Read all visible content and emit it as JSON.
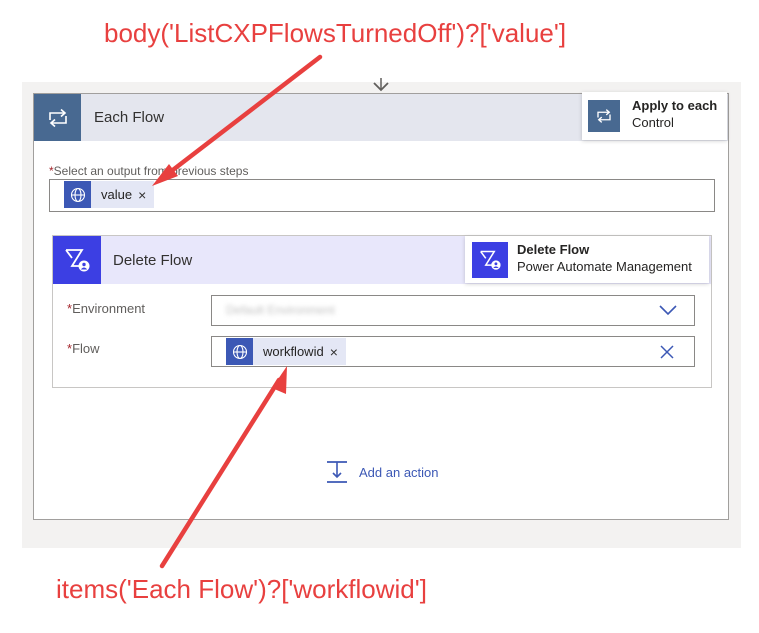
{
  "annotations": {
    "top": "body('ListCXPFlowsTurnedOff')?['value']",
    "bottom": "items('Each  Flow')?['workflowid']"
  },
  "loop": {
    "title": "Each Flow",
    "icon": "loop-icon",
    "tooltip": {
      "name": "Apply to each",
      "connector": "Control"
    },
    "select_label_required": "*",
    "select_label": "Select an output from previous steps",
    "token": {
      "label": "value",
      "remove": "×",
      "icon": "globe-icon"
    }
  },
  "action": {
    "title": "Delete Flow",
    "icon": "power-automate-management-icon",
    "tooltip": {
      "name": "Delete Flow",
      "connector": "Power Automate Management"
    },
    "fields": {
      "environment": {
        "required": "*",
        "label": "Environment",
        "value": "Default Environment"
      },
      "flow": {
        "required": "*",
        "label": "Flow",
        "token": {
          "label": "workflowid",
          "remove": "×",
          "icon": "globe-icon"
        }
      }
    }
  },
  "add_action": {
    "label": "Add an action",
    "icon": "add-action-icon"
  },
  "colors": {
    "annotation": "#e8403f",
    "loop_accent": "#486991",
    "action_accent": "#3c3fe3",
    "token_icon": "#3c58b5",
    "link": "#3c58b5"
  }
}
